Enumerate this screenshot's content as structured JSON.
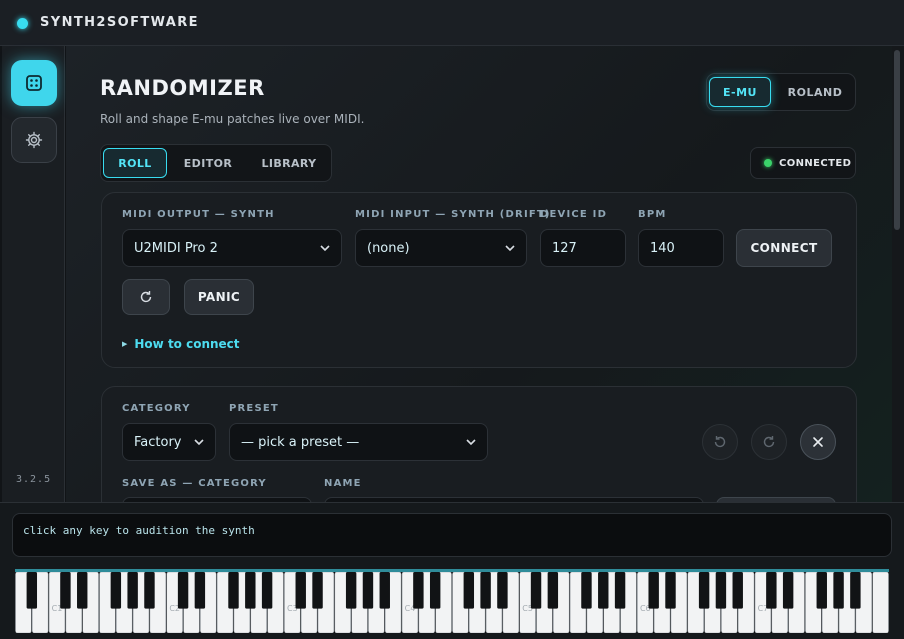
{
  "app": {
    "title": "SYNTH2SOFTWARE",
    "version": "3.2.5"
  },
  "sidebar": {
    "items": [
      {
        "icon": "dice-icon",
        "active": true
      },
      {
        "icon": "gear-icon",
        "active": false
      }
    ]
  },
  "header": {
    "title": "RANDOMIZER",
    "subtitle": "Roll and shape E-mu patches live over MIDI."
  },
  "brand_toggle": {
    "options": [
      "E-MU",
      "ROLAND"
    ],
    "selected": "E-MU"
  },
  "tabs": {
    "items": [
      "ROLL",
      "EDITOR",
      "LIBRARY"
    ],
    "selected": "ROLL"
  },
  "status": {
    "label": "CONNECTED",
    "color": "#3bd36a"
  },
  "midi": {
    "output_label": "MIDI OUTPUT — SYNTH",
    "output_value": "U2MIDI Pro 2",
    "input_label": "MIDI INPUT — SYNTH (DRIFT)",
    "input_value": "(none)",
    "device_id_label": "DEVICE ID",
    "device_id_value": "127",
    "bpm_label": "BPM",
    "bpm_value": "140",
    "connect_label": "CONNECT",
    "panic_label": "PANIC",
    "how_to_label": "How to connect"
  },
  "preset": {
    "category_label": "CATEGORY",
    "category_value": "Factory",
    "preset_label": "PRESET",
    "preset_placeholder": "— pick a preset —",
    "save_category_label": "SAVE AS — CATEGORY",
    "name_label": "NAME"
  },
  "keyboard": {
    "hint": "click any key to audition the synth",
    "octave_labels": [
      "C1",
      "C2",
      "C3",
      "C4",
      "C5",
      "C6",
      "C7"
    ]
  },
  "colors": {
    "accent": "#38dcf0",
    "background": "#111417"
  }
}
